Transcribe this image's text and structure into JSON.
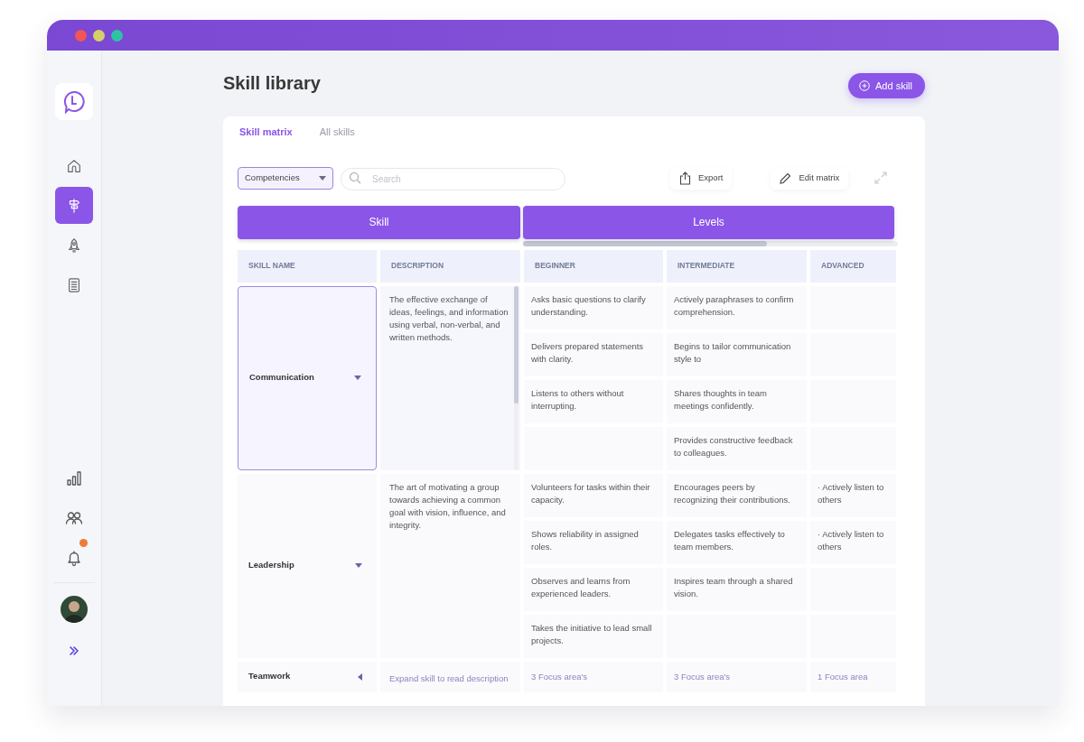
{
  "sidebar": {
    "nav_items": [
      {
        "kind": "home",
        "selected": false
      },
      {
        "kind": "signpost",
        "selected": true
      },
      {
        "kind": "rocket",
        "selected": false
      },
      {
        "kind": "list",
        "selected": false
      }
    ],
    "bottom_items": [
      {
        "kind": "chart",
        "notification": false
      },
      {
        "kind": "people",
        "notification": false
      },
      {
        "kind": "bell",
        "notification": true
      },
      {
        "kind": "avatar",
        "notification": false
      },
      {
        "kind": "expand",
        "notification": false
      }
    ]
  },
  "title": "Skill library",
  "add_button": "Add skill",
  "tabs": [
    {
      "label": "Skill matrix",
      "selected": true
    },
    {
      "label": "All skills",
      "selected": false
    }
  ],
  "toolbar": {
    "filter": "Competencies",
    "search_placeholder": "Search",
    "export": "Export",
    "edit": "Edit matrix"
  },
  "matrix": {
    "groups": [
      "Skill",
      "Levels"
    ],
    "columns": [
      "SKILL NAME",
      "DESCRIPTION",
      "BEGINNER",
      "INTERMEDIATE",
      "ADVANCED"
    ],
    "skills": [
      {
        "name": "Communication",
        "expanded": true,
        "selected": true,
        "description": "The effective exchange of ideas, feelings, and information using verbal, non-verbal, and written methods.",
        "rows": [
          {
            "beginner": "Asks basic questions to clarify understanding.",
            "intermediate": "Actively paraphrases to confirm comprehension."
          },
          {
            "beginner": "Delivers prepared statements with clarity.",
            "intermediate": "Begins to tailor communication style to"
          },
          {
            "beginner": "Listens to others without interrupting.",
            "intermediate": "Shares thoughts in team meetings confidently."
          },
          {
            "intermediate": "Provides constructive feedback to colleagues."
          }
        ]
      },
      {
        "name": "Leadership",
        "expanded": true,
        "selected": false,
        "description": "The art of motivating a group towards achieving a common goal with vision, influence, and integrity.",
        "rows": [
          {
            "beginner": "Volunteers for tasks within their capacity.",
            "intermediate": "Encourages peers by recognizing their contributions.",
            "advanced": "· Actively listen to others"
          },
          {
            "beginner": "Shows reliability in assigned roles.",
            "intermediate": "Delegates tasks effectively to team members.",
            "advanced": "· Actively listen to others"
          },
          {
            "beginner": "Observes and learns from experienced leaders.",
            "intermediate": "Inspires team through a shared vision."
          },
          {
            "beginner": "Takes the initiative to lead small projects."
          }
        ]
      },
      {
        "name": "Teamwork",
        "expanded": false,
        "selected": false,
        "description": "Expand skill to read description",
        "rows": [
          {
            "beginner": "3 Focus area's",
            "intermediate": "3 Focus area's",
            "advanced": "1 Focus area"
          }
        ]
      }
    ]
  }
}
